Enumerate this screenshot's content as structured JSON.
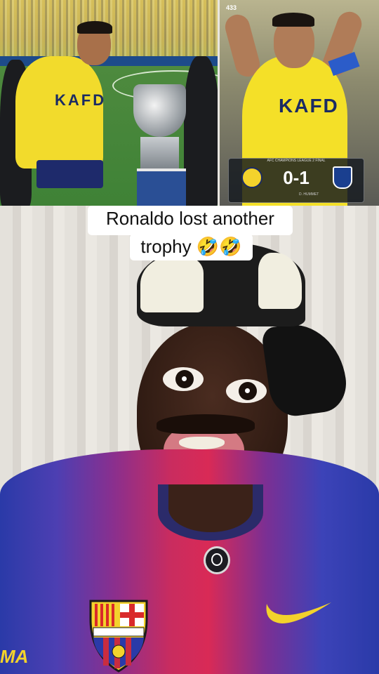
{
  "caption": {
    "line1": "Ronaldo lost another",
    "line2": "trophy 🤣🤣"
  },
  "top_left_photo": {
    "jersey_text": "KAFD"
  },
  "top_right_photo": {
    "corner_tag": "433",
    "jersey_text": "KAFD",
    "scoreboard": {
      "score": "0-1",
      "caption": "AFC CHAMPIONS LEAGUE 2 FINAL",
      "scorer": "D. HUMMET"
    }
  },
  "bottom_photo": {
    "sleeve_text": "MA"
  },
  "colors": {
    "alnassr_yellow": "#f2db2c",
    "barca_blue": "#2a3aa8",
    "barca_red": "#d92a56",
    "caption_bg": "#ffffff",
    "swoosh": "#f3d22c"
  }
}
